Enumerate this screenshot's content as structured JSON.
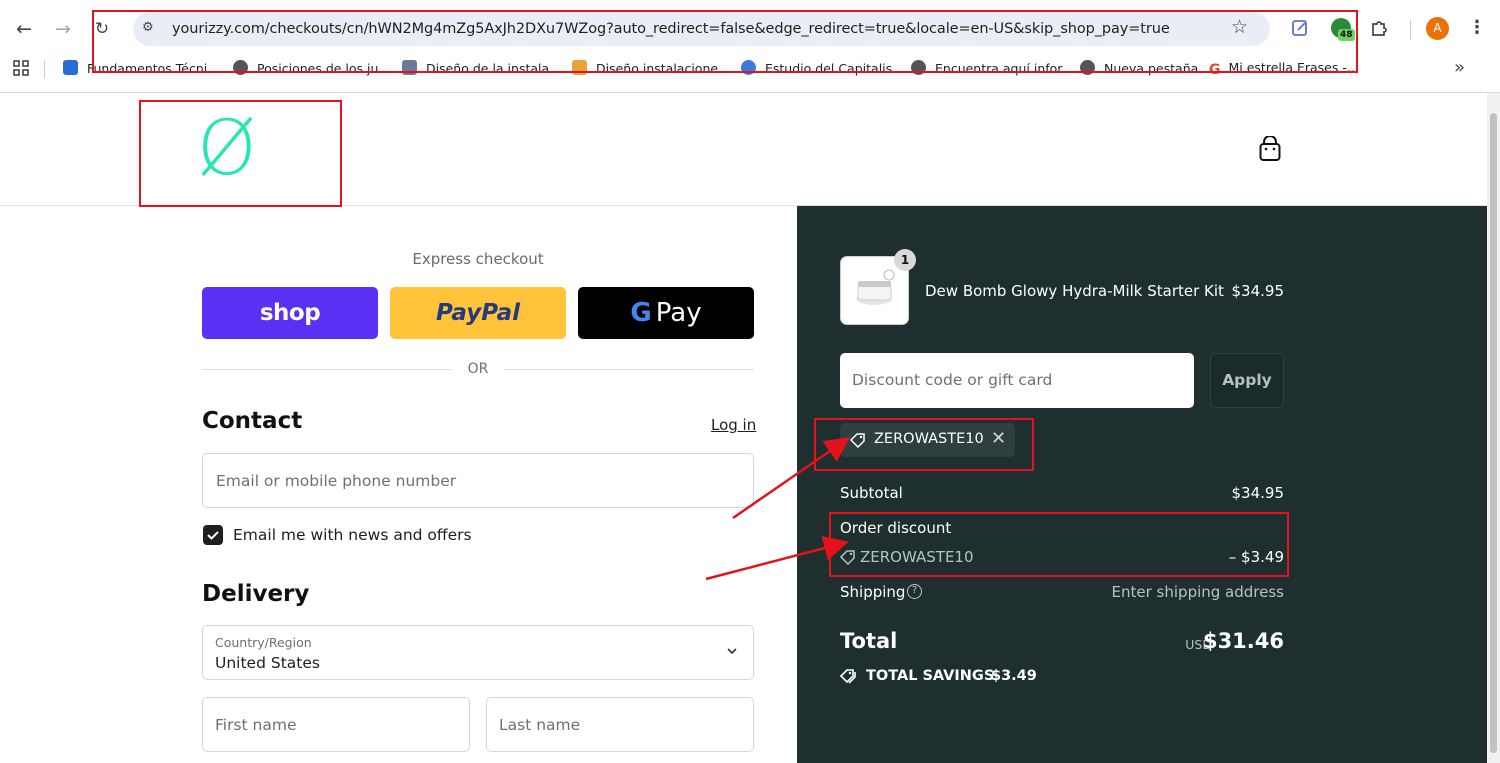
{
  "browser": {
    "url": "yourizzy.com/checkouts/cn/hWN2Mg4mZg5AxJh2DXu7WZog?auto_redirect=false&edge_redirect=true&locale=en-US&skip_shop_pay=true",
    "extension_badge": "48",
    "profile_initial": "A",
    "bookmarks": [
      {
        "label": "Fundamentos Técni...",
        "color": "#2b6cd4"
      },
      {
        "label": "Posiciones de los ju...",
        "color": "#555555"
      },
      {
        "label": "Diseño de la instala...",
        "color": "#6b7a99"
      },
      {
        "label": "Diseño instalacione...",
        "color": "#e8a33d"
      },
      {
        "label": "Estudio del Capitalis...",
        "color": "#3b7be0"
      },
      {
        "label": "Encuentra aquí infor...",
        "color": "#555555"
      },
      {
        "label": "Nueva pestaña",
        "color": "#555555"
      },
      {
        "label": "Mi estrella Erases -...",
        "color": "#ea4335"
      }
    ]
  },
  "store": {
    "logo_glyph": "Ø",
    "logo_color": "#27e6b6"
  },
  "checkout": {
    "express_title": "Express checkout",
    "shop_label": "shop",
    "paypal_label": "PayPal",
    "gpay_label": "Pay",
    "or_label": "OR",
    "contact_heading": "Contact",
    "login_link": "Log in",
    "email_placeholder": "Email or mobile phone number",
    "newsletter_label": "Email me with news and offers",
    "newsletter_checked": true,
    "delivery_heading": "Delivery",
    "country_label": "Country/Region",
    "country_value": "United States",
    "first_name_placeholder": "First name",
    "last_name_placeholder": "Last name"
  },
  "summary": {
    "item": {
      "name": "Dew Bomb Glowy Hydra-Milk Starter Kit",
      "price": "$34.95",
      "quantity": "1"
    },
    "discount_placeholder": "Discount code or gift card",
    "apply_label": "Apply",
    "applied_code": "ZEROWASTE10",
    "subtotal_label": "Subtotal",
    "subtotal_value": "$34.95",
    "order_discount_label": "Order discount",
    "order_discount_code": "ZEROWASTE10",
    "order_discount_value": "– $3.49",
    "shipping_label": "Shipping",
    "shipping_value": "Enter shipping address",
    "total_label": "Total",
    "currency": "USD",
    "total_value": "$31.46",
    "savings_label": "TOTAL SAVINGS",
    "savings_value": "$3.49"
  },
  "colors": {
    "annotation_red": "#e3121b",
    "summary_bg": "#1f2f2f",
    "shop_purple": "#5a31f4",
    "paypal_yellow": "#ffc439"
  }
}
